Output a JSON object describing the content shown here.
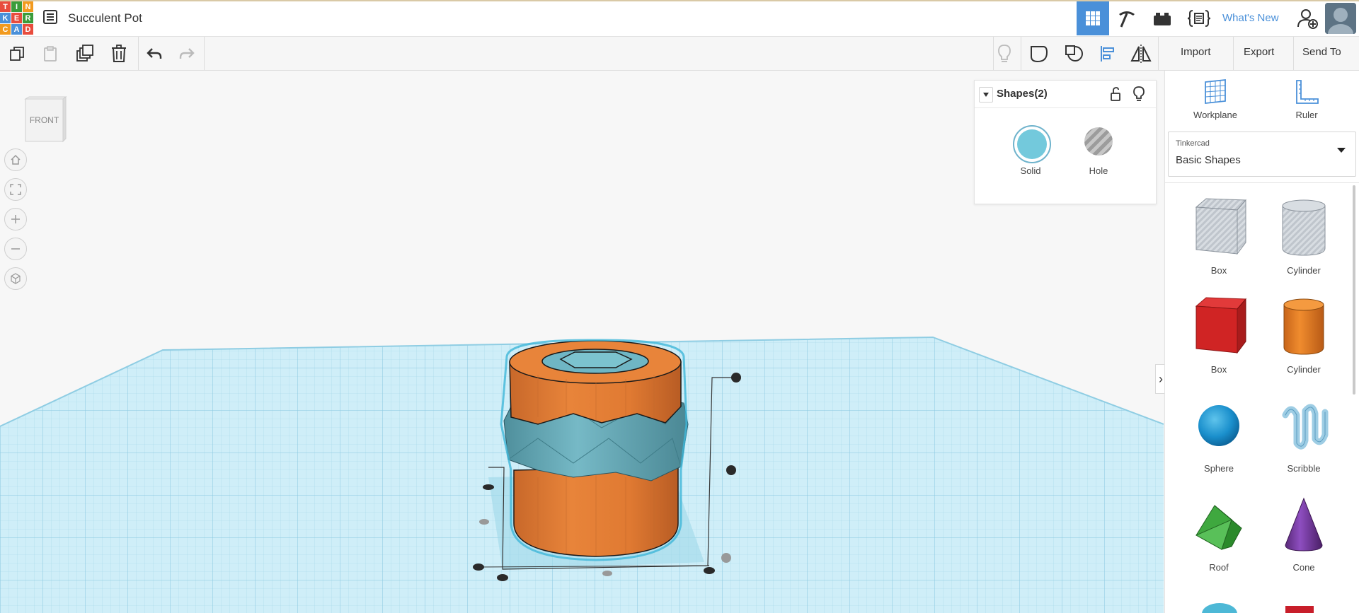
{
  "header": {
    "logo_letters": [
      "T",
      "I",
      "N",
      "K",
      "E",
      "R",
      "C",
      "A",
      "D"
    ],
    "logo_colors": [
      "#e84c3d",
      "#3b9c3b",
      "#f29a1e",
      "#4a90d9",
      "#e84c3d",
      "#3b9c3b",
      "#f29a1e",
      "#4a90d9",
      "#e84c3d"
    ],
    "doc_title": "Succulent Pot",
    "whats_new": "What's New",
    "icons": [
      "grid-view-icon",
      "pickaxe-icon",
      "bricks-icon",
      "code-blocks-icon"
    ]
  },
  "toolbar": {
    "import_label": "Import",
    "export_label": "Export",
    "send_to_label": "Send To"
  },
  "viewcube": {
    "face_label": "FRONT"
  },
  "shapes_panel": {
    "title": "Shapes(2)",
    "solid_label": "Solid",
    "hole_label": "Hole"
  },
  "right_panel": {
    "workplane_label": "Workplane",
    "ruler_label": "Ruler",
    "library_source": "Tinkercad",
    "library_name": "Basic Shapes",
    "shapes": [
      {
        "label": "Box"
      },
      {
        "label": "Cylinder"
      },
      {
        "label": "Box"
      },
      {
        "label": "Cylinder"
      },
      {
        "label": "Sphere"
      },
      {
        "label": "Scribble"
      },
      {
        "label": "Roof"
      },
      {
        "label": "Cone"
      }
    ]
  },
  "colors": {
    "accent_blue": "#4a90d9",
    "pot_orange": "#e8843a",
    "band_teal": "#6fb6c4",
    "grid_blue": "#bfe6f3"
  }
}
